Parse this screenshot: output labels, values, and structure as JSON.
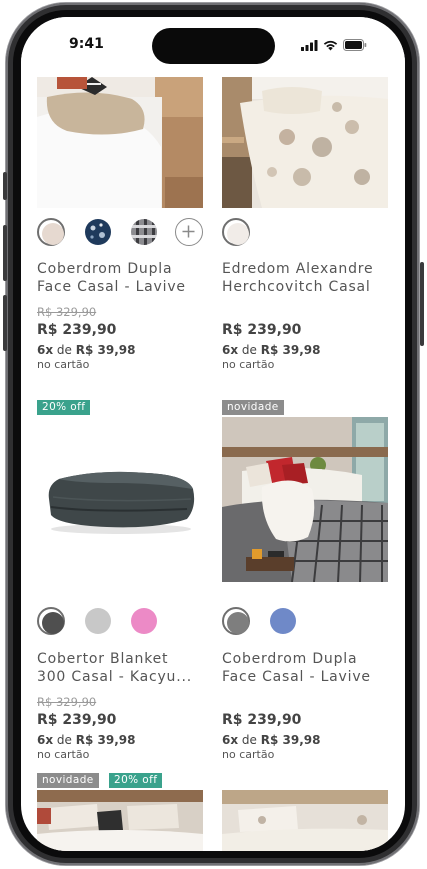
{
  "status_bar": {
    "time": "9:41"
  },
  "products": [
    {
      "title_line1": "Coberdrom Dupla",
      "title_line2": "Face Casal - Lavive",
      "old_price": "R$ 329,90",
      "price": "R$ 239,90",
      "installments_prefix": "6x",
      "installments_de": "de",
      "installments_value": "R$ 39,98",
      "card_note": "no cartão",
      "swatches": [
        "beige-swatch",
        "navy-floral-swatch",
        "plaid-swatch"
      ],
      "more_icon": "plus-icon"
    },
    {
      "title_line1": "Edredom Alexandre",
      "title_line2": "Herchcovitch Casal",
      "price": "R$ 239,90",
      "installments_prefix": "6x",
      "installments_de": "de",
      "installments_value": "R$ 39,98",
      "card_note": "no cartão",
      "swatches": [
        "ivory-swatch"
      ]
    },
    {
      "badge": "20% off",
      "title_line1": "Cobertor Blanket",
      "title_line2": "300 Casal - Kacyu...",
      "old_price": "R$ 329,90",
      "price": "R$ 239,90",
      "installments_prefix": "6x",
      "installments_de": "de",
      "installments_value": "R$ 39,98",
      "card_note": "no cartão",
      "swatches": [
        "dark-gray-swatch",
        "light-gray-swatch",
        "pink-swatch"
      ]
    },
    {
      "badge": "novidade",
      "title_line1": "Coberdrom Dupla",
      "title_line2": "Face Casal - Lavive",
      "price": "R$ 239,90",
      "installments_prefix": "6x",
      "installments_de": "de",
      "installments_value": "R$ 39,98",
      "card_note": "no cartão",
      "swatches": [
        "gray-swatch",
        "blue-swatch"
      ]
    },
    {
      "badge": "novidade",
      "badge2": "20% off"
    },
    {}
  ],
  "colors": {
    "badge_green": "#3aa28c",
    "badge_gray": "#8c8c8c",
    "price_text": "#444444"
  }
}
